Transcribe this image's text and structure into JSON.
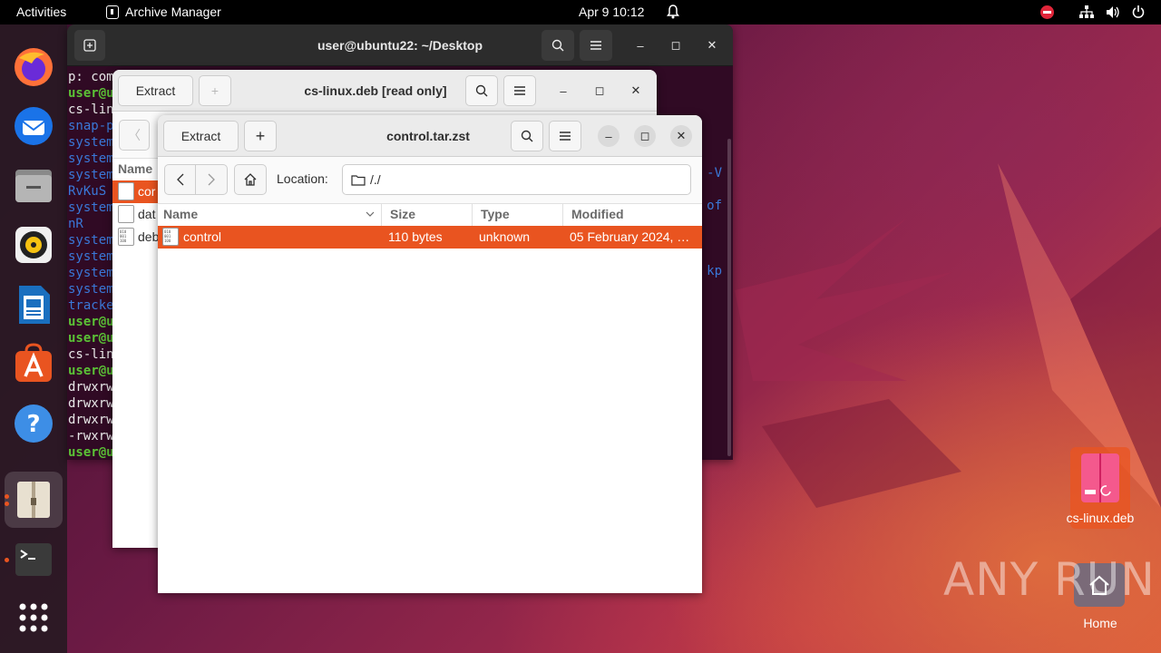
{
  "topbar": {
    "activities": "Activities",
    "app_name": "Archive Manager",
    "clock": "Apr 9  10:12"
  },
  "dock": {
    "items": [
      "firefox",
      "thunderbird",
      "files",
      "rhythmbox",
      "libreoffice-writer",
      "app-center",
      "help",
      "archive-manager",
      "terminal",
      "show-apps"
    ]
  },
  "terminal": {
    "title": "user@ubuntu22: ~/Desktop",
    "lines": [
      {
        "text": "p: com",
        "style": "w"
      },
      {
        "text": "user@u",
        "style": "g"
      },
      {
        "text": "cs-lin",
        "style": "w"
      },
      {
        "text": "snap-p",
        "style": "b"
      },
      {
        "text": "system",
        "style": "b"
      },
      {
        "text": "system",
        "style": "b"
      },
      {
        "text": "system",
        "style": "b"
      },
      {
        "text": "RvKuS",
        "style": "b"
      },
      {
        "text": "system",
        "style": "b"
      },
      {
        "text": "nR",
        "style": "b"
      },
      {
        "text": "system",
        "style": "b"
      },
      {
        "text": "system",
        "style": "b"
      },
      {
        "text": "system",
        "style": "b"
      },
      {
        "text": "system",
        "style": "b"
      },
      {
        "text": "tracke",
        "style": "b"
      },
      {
        "text": "user@u",
        "style": "g"
      },
      {
        "text": "user@u",
        "style": "g"
      },
      {
        "text": "cs-lin",
        "style": "w"
      },
      {
        "text": "user@u",
        "style": "g"
      },
      {
        "text": "drwxrw",
        "style": "w"
      },
      {
        "text": "drwxrw",
        "style": "w"
      },
      {
        "text": "drwxrw",
        "style": "w"
      },
      {
        "text": "-rwxrw",
        "style": "w"
      },
      {
        "text": "user@u",
        "style": "g"
      }
    ],
    "right_fragments": [
      "-V",
      "of",
      "kp"
    ]
  },
  "archive_back": {
    "title": "cs-linux.deb [read only]",
    "extract_label": "Extract",
    "add_label": "+",
    "column_name": "Name",
    "rows": [
      {
        "name": "cor",
        "selected": true
      },
      {
        "name": "dat",
        "selected": false
      },
      {
        "name": "deb",
        "selected": false
      }
    ]
  },
  "archive_front": {
    "title": "control.tar.zst",
    "extract_label": "Extract",
    "add_label": "+",
    "location_label": "Location:",
    "location_value": "/./",
    "columns": {
      "name": "Name",
      "size": "Size",
      "type": "Type",
      "modified": "Modified"
    },
    "rows": [
      {
        "name": "control",
        "size": "110 bytes",
        "type": "unknown",
        "modified": "05 February 2024, …"
      }
    ]
  },
  "desktop": {
    "deb_icon_label": "cs-linux.deb",
    "home_label": "Home",
    "watermark": "ANY RUN"
  },
  "colors": {
    "accent": "#e95420",
    "terminal_bg": "#300a24",
    "prompt_green": "#5bc236",
    "link_blue": "#3a78d8"
  }
}
